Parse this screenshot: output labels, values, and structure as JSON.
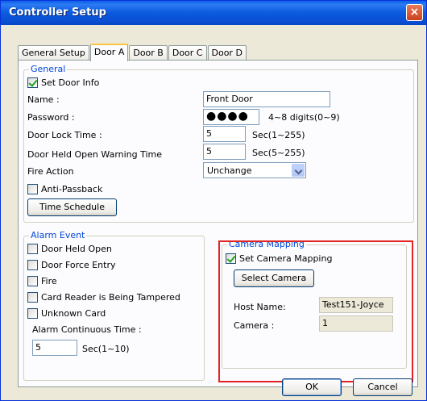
{
  "window": {
    "title": "Controller Setup",
    "close_label": "×"
  },
  "tabs": [
    {
      "label": "General Setup"
    },
    {
      "label": "Door A"
    },
    {
      "label": "Door B"
    },
    {
      "label": "Door C"
    },
    {
      "label": "Door D"
    }
  ],
  "general": {
    "group_title": "General",
    "set_door_info_label": "Set Door Info",
    "set_door_info_checked": true,
    "name_label": "Name :",
    "name_value": "Front  Door",
    "password_label": "Password :",
    "password_value": "●●●●",
    "password_hint": "4~8 digits(0~9)",
    "lock_time_label": "Door Lock Time :",
    "lock_time_value": "5",
    "lock_time_hint": "Sec(1~255)",
    "held_open_label": "Door Held Open Warning Time",
    "held_open_value": "5",
    "held_open_hint": "Sec(5~255)",
    "fire_action_label": "Fire Action",
    "fire_action_value": "Unchange",
    "anti_passback_label": "Anti-Passback",
    "anti_passback_checked": false,
    "time_schedule_label": "Time Schedule"
  },
  "alarm": {
    "group_title": "Alarm Event",
    "items": [
      {
        "label": "Door Held Open",
        "checked": false
      },
      {
        "label": "Door Force Entry",
        "checked": false
      },
      {
        "label": "Fire",
        "checked": false
      },
      {
        "label": "Card Reader is Being Tampered",
        "checked": false
      },
      {
        "label": "Unknown Card",
        "checked": false
      }
    ],
    "continuous_label": "Alarm Continuous Time :",
    "continuous_value": "5",
    "continuous_hint": "Sec(1~10)"
  },
  "camera": {
    "group_title": "Camera Mapping",
    "set_mapping_label": "Set Camera Mapping",
    "set_mapping_checked": true,
    "select_camera_label": "Select Camera",
    "host_name_label": "Host Name:",
    "host_name_value": "Test151-Joyce",
    "camera_label": "Camera :",
    "camera_value": "1",
    "highlight_color": "#e32424"
  },
  "footer": {
    "ok_label": "OK",
    "cancel_label": "Cancel"
  }
}
